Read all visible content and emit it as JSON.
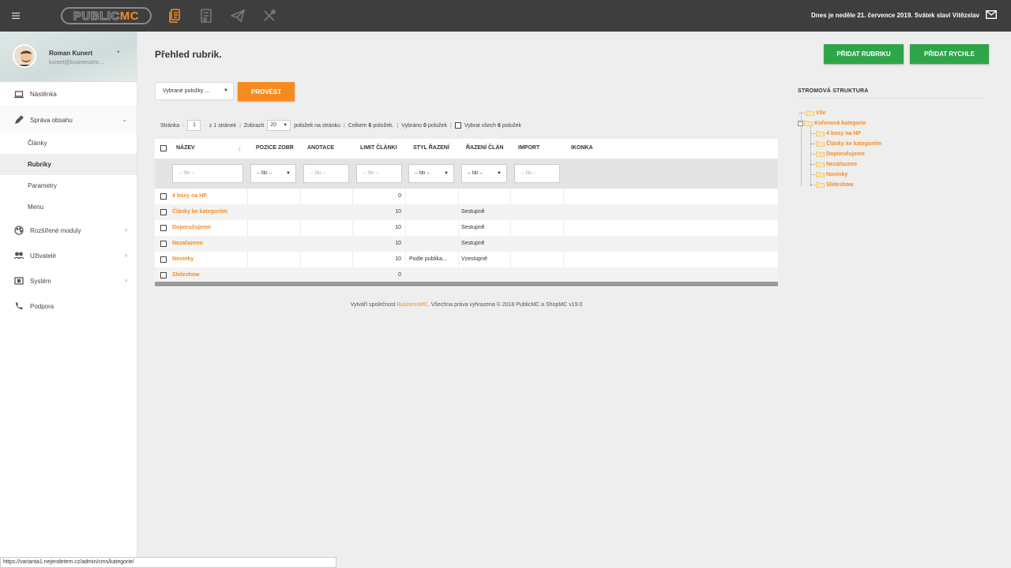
{
  "topbar": {
    "menu_icon": "hamburger-icon",
    "logo_part1": "PUBLIC",
    "logo_part2": "MC",
    "date_text": "Dnes je neděle 21. července 2019. Svátek slaví Vítězslav",
    "accent": "#f68b1f"
  },
  "user": {
    "name": "Roman Kunert",
    "email": "kunert@businessmc..."
  },
  "sidebar": {
    "items": [
      {
        "label": "Nástěnka"
      },
      {
        "label": "Správa obsahu"
      },
      {
        "label": "Články"
      },
      {
        "label": "Rubriky"
      },
      {
        "label": "Parametry"
      },
      {
        "label": "Menu"
      },
      {
        "label": "Rozšířené moduly"
      },
      {
        "label": "Uživatelé"
      },
      {
        "label": "Systém"
      },
      {
        "label": "Podpora"
      }
    ]
  },
  "main": {
    "title": "Přehled rubrik.",
    "add_rubric": "PŘIDAT RUBRIKU",
    "add_fast": "PŘIDAT RYCHLE",
    "bulk_select": "Vybrané položky ...",
    "execute": "PROVÉST"
  },
  "pager": {
    "page_label": "Stránka",
    "page_value": "1",
    "of_pages": "z 1 stránek",
    "show_label": "Zobrazit",
    "per_page": "20",
    "per_page_suffix": "položek na stránku",
    "total_prefix": "Celkem",
    "total_count": "6",
    "total_suffix": "položek.",
    "selected_prefix": "Vybráno",
    "selected_count": "0",
    "selected_suffix": "položek",
    "select_all_prefix": "Vybrat všech",
    "select_all_count": "6",
    "select_all_suffix": "položek"
  },
  "table": {
    "headers": [
      "NÁZEV",
      "POZICE ZOBR",
      "ANOTACE",
      "LIMIT ČLÁNKI",
      "STYL ŘAZENÍ",
      "ŘAZENÍ ČLÁN",
      "IMPORT",
      "IKONKA"
    ],
    "filter_placeholder": "-- filtr --",
    "filter_select": "-- filtr --",
    "rows": [
      {
        "name": "4 boxy na HP",
        "limit": "0",
        "styl": "",
        "razeni": ""
      },
      {
        "name": "Články ke kategoriím",
        "limit": "10",
        "styl": "",
        "razeni": "Sestupně"
      },
      {
        "name": "Doporučujeme",
        "limit": "10",
        "styl": "",
        "razeni": "Sestupně"
      },
      {
        "name": "Nezařazeno",
        "limit": "10",
        "styl": "",
        "razeni": "Sestupně"
      },
      {
        "name": "Novinky",
        "limit": "10",
        "styl": "Podle publika...",
        "razeni": "Vzestupně"
      },
      {
        "name": "Slideshow",
        "limit": "0",
        "styl": "",
        "razeni": ""
      }
    ]
  },
  "footer": {
    "prefix": "Vytváří společnost",
    "brand": "BusinessMC",
    "suffix": ". Všechna práva vyhrazena © 2018 PublicMC a ShopMC v19.0"
  },
  "tree": {
    "title": "STROMOVÁ STRUKTURA",
    "root": "Vše",
    "node": "Kořenová kategorie",
    "children": [
      "4 boxy na HP",
      "Články ke kategoriím",
      "Doporučujeme",
      "Nezařazeno",
      "Novinky",
      "Slideshow"
    ]
  },
  "statusbar": {
    "url": "https://varianta1.nejendetem.cz/admin/cms/kategorie/"
  }
}
